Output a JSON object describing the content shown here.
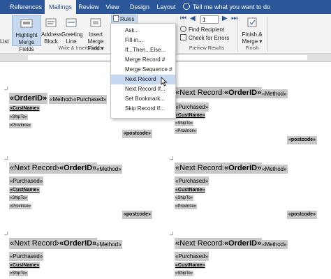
{
  "tabs": [
    {
      "label": "References"
    },
    {
      "label": "Mailings"
    },
    {
      "label": "Review"
    },
    {
      "label": "View"
    },
    {
      "label": "Design"
    },
    {
      "label": "Layout"
    }
  ],
  "tell_me": "Tell me what you want to do",
  "ribbon": {
    "list_fragment": "List",
    "highlight": {
      "line1": "Highlight",
      "line2": "Merge Fields"
    },
    "address": {
      "line1": "Address",
      "line2": "Block"
    },
    "greeting": {
      "line1": "Greeting",
      "line2": "Line"
    },
    "insert": {
      "line1": "Insert Merge",
      "line2": "Field ▾"
    },
    "write_insert_label": "Write & Insert Fields",
    "rules_label": "Rules ▾",
    "record_number": "1",
    "find_recipient": "Find Recipient",
    "check_errors": "Check for Errors",
    "preview_label": "Preview Results",
    "finish": {
      "line1": "Finish &",
      "line2": "Merge ▾"
    },
    "finish_label": "Finish"
  },
  "menu_items": [
    {
      "label": "Ask..."
    },
    {
      "label": "Fill-in..."
    },
    {
      "label": "If...Then...Else..."
    },
    {
      "label": "Merge Record #"
    },
    {
      "label": "Merge Sequence #"
    },
    {
      "label": "Next Record"
    },
    {
      "label": "Next Record If..."
    },
    {
      "label": "Set Bookmark..."
    },
    {
      "label": "Skip Record If..."
    }
  ],
  "fields": {
    "orderid": "«OrderID»",
    "method": "«Method»",
    "purchased": "«Purchased»",
    "custname": "«CustName»",
    "shipto": "«ShipTo»",
    "province": "«Province»",
    "postcode": "«postcode»",
    "next_record": "«Next Record»"
  },
  "colors": {
    "tab_bar": "#2b579a",
    "field_shading": "#c8c8c8",
    "menu_highlight": "#c5d8ef"
  }
}
